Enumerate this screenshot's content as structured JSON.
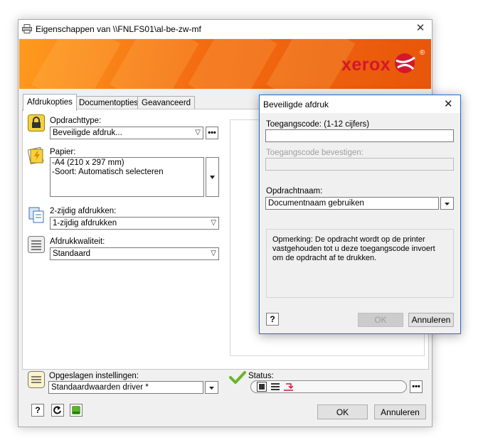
{
  "main_window": {
    "title": "Eigenschappen van \\\\FNLFS01\\al-be-zw-mf",
    "close_symbol": "✕"
  },
  "banner": {
    "brand": "xerox",
    "registered": "®",
    "colors": {
      "orange": "#f36b10",
      "red": "#d3172e"
    }
  },
  "tabs": [
    {
      "label": "Afdrukopties",
      "active": true
    },
    {
      "label": "Documentopties",
      "active": false
    },
    {
      "label": "Geavanceerd",
      "active": false
    }
  ],
  "job_type": {
    "label": "Opdrachttype:",
    "value": "Beveiligde afdruk...",
    "more_label": "•••"
  },
  "paper": {
    "label": "Papier:",
    "lines": [
      "-A4 (210 x 297 mm)",
      "-Soort: Automatisch selecteren"
    ]
  },
  "duplex": {
    "label": "2-zijdig afdrukken:",
    "value": "1-zijdig afdrukken"
  },
  "quality": {
    "label": "Afdrukkwaliteit:",
    "value": "Standaard"
  },
  "saved_settings": {
    "label": "Opgeslagen instellingen:",
    "value": "Standaardwaarden driver *"
  },
  "status": {
    "label": "Status:",
    "more_label": "•••"
  },
  "bottom": {
    "help_label": "?",
    "ok_label": "OK",
    "cancel_label": "Annuleren"
  },
  "dialog": {
    "title": "Beveiligde afdruk",
    "close_symbol": "✕",
    "passcode_label": "Toegangscode: (1-12 cijfers)",
    "passcode_value": "",
    "confirm_label": "Toegangscode bevestigen:",
    "confirm_value": "",
    "jobname_label": "Opdrachtnaam:",
    "jobname_value": "Documentnaam gebruiken",
    "note": "Opmerking: De opdracht wordt op de printer vastgehouden tot u deze toegangscode invoert om de opdracht af te drukken.",
    "help_label": "?",
    "ok_label": "OK",
    "cancel_label": "Annuleren"
  }
}
